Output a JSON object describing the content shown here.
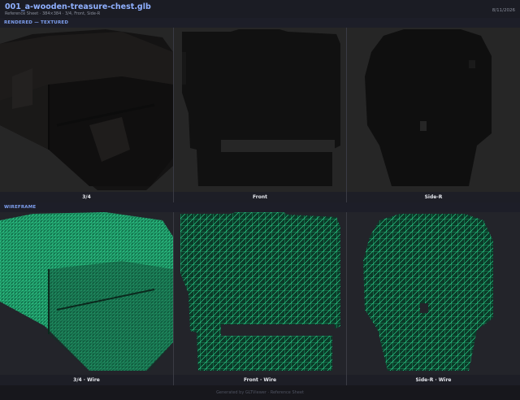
{
  "header": {
    "title": "001_a-wooden-treasure-chest.glb",
    "subtitle": "Reference Sheet  ·  384×384  ·  3/4, Front, Side-R",
    "date": "8/11/2026"
  },
  "sections": {
    "rendered": "RENDERED — TEXTURED",
    "wireframe": "WIREFRAME"
  },
  "rendered_views": [
    {
      "label": "3/4"
    },
    {
      "label": "Front"
    },
    {
      "label": "Side-R"
    }
  ],
  "wire_views": [
    {
      "label": "3/4 · Wire"
    },
    {
      "label": "Front · Wire"
    },
    {
      "label": "Side-R · Wire"
    }
  ],
  "colors": {
    "background": "#17171c",
    "accent": "#8fb0ff",
    "wire": "#2ee89a",
    "render_dark": "#141414"
  },
  "footer": "Generated by GLTViewer · Reference Sheet"
}
